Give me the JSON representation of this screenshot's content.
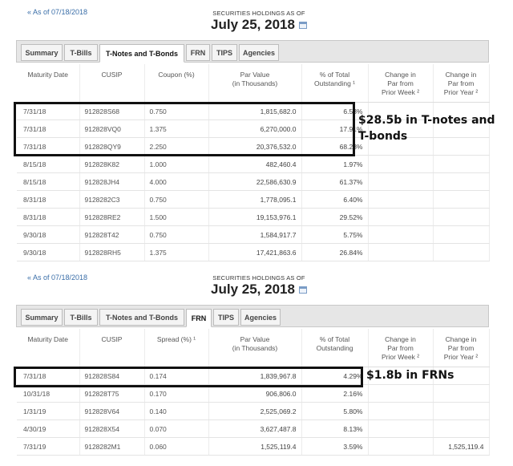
{
  "panels": [
    {
      "back_link": "« As of 07/18/2018",
      "title_small": "SECURITIES HOLDINGS AS OF",
      "title_date": "July 25, 2018",
      "tabs": [
        "Summary",
        "T-Bills",
        "T-Notes and T-Bonds",
        "FRN",
        "TIPS",
        "Agencies"
      ],
      "active_tab": "T-Notes and T-Bonds",
      "columns": [
        "Maturity Date",
        "CUSIP",
        "Coupon (%)",
        "Par Value\n(in Thousands)",
        "% of Total\nOutstanding ¹",
        "Change in\nPar from\nPrior Week ²",
        "Change in\nPar from\nPrior Year ²"
      ],
      "rows": [
        [
          "7/31/18",
          "912828S68",
          "0.750",
          "1,815,682.0",
          "6.53%",
          "",
          ""
        ],
        [
          "7/31/18",
          "912828VQ0",
          "1.375",
          "6,270,000.0",
          "17.91%",
          "",
          ""
        ],
        [
          "7/31/18",
          "912828QY9",
          "2.250",
          "20,376,532.0",
          "68.23%",
          "",
          ""
        ],
        [
          "8/15/18",
          "912828K82",
          "1.000",
          "482,460.4",
          "1.97%",
          "",
          ""
        ],
        [
          "8/15/18",
          "912828JH4",
          "4.000",
          "22,586,630.9",
          "61.37%",
          "",
          ""
        ],
        [
          "8/31/18",
          "9128282C3",
          "0.750",
          "1,778,095.1",
          "6.40%",
          "",
          ""
        ],
        [
          "8/31/18",
          "912828RE2",
          "1.500",
          "19,153,976.1",
          "29.52%",
          "",
          ""
        ],
        [
          "9/30/18",
          "912828T42",
          "0.750",
          "1,584,917.7",
          "5.75%",
          "",
          ""
        ],
        [
          "9/30/18",
          "912828RH5",
          "1.375",
          "17,421,863.6",
          "26.84%",
          "",
          ""
        ]
      ],
      "annotation_lines": [
        "$28.5b in T-notes and",
        "T-bonds"
      ]
    },
    {
      "back_link": "« As of 07/18/2018",
      "title_small": "SECURITIES HOLDINGS AS OF",
      "title_date": "July 25, 2018",
      "tabs": [
        "Summary",
        "T-Bills",
        "T-Notes and T-Bonds",
        "FRN",
        "TIPS",
        "Agencies"
      ],
      "active_tab": "FRN",
      "columns": [
        "Maturity Date",
        "CUSIP",
        "Spread (%) ¹",
        "Par Value\n(in Thousands)",
        "% of Total\nOutstanding",
        "Change in\nPar from\nPrior Week ²",
        "Change in\nPar from\nPrior Year ²"
      ],
      "rows": [
        [
          "7/31/18",
          "912828S84",
          "0.174",
          "1,839,967.8",
          "4.29%",
          "",
          ""
        ],
        [
          "10/31/18",
          "912828T75",
          "0.170",
          "906,806.0",
          "2.16%",
          "",
          ""
        ],
        [
          "1/31/19",
          "912828V64",
          "0.140",
          "2,525,069.2",
          "5.80%",
          "",
          ""
        ],
        [
          "4/30/19",
          "912828X54",
          "0.070",
          "3,627,487.8",
          "8.13%",
          "",
          ""
        ],
        [
          "7/31/19",
          "9128282M1",
          "0.060",
          "1,525,119.4",
          "3.59%",
          "",
          "1,525,119.4"
        ]
      ],
      "annotation_lines": [
        "$1.8b in FRNs"
      ]
    }
  ]
}
